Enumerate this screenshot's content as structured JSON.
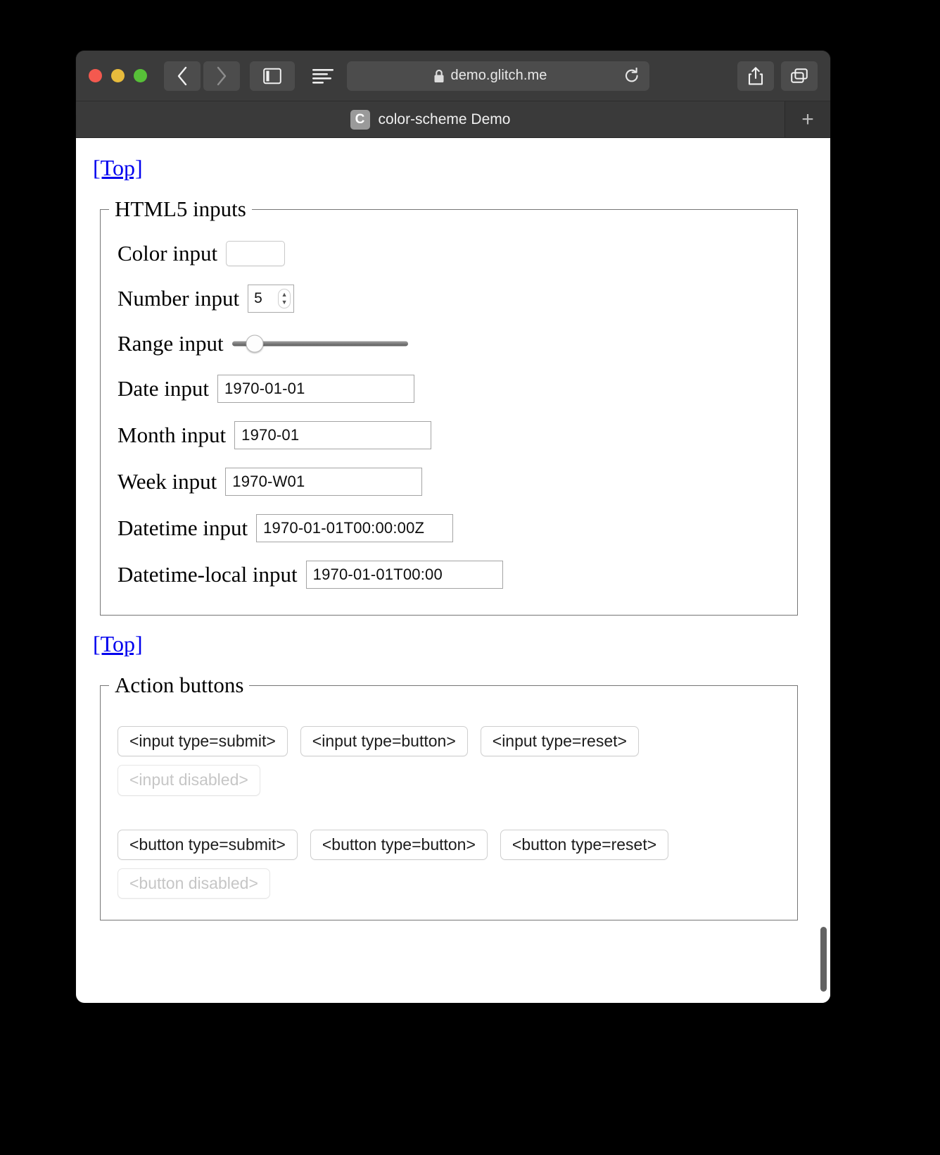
{
  "window": {
    "traffic_lights": [
      {
        "name": "close",
        "color": "#f4594f"
      },
      {
        "name": "minimize",
        "color": "#e7bb3c"
      },
      {
        "name": "zoom",
        "color": "#57c038"
      }
    ]
  },
  "toolbar": {
    "back_label": "‹",
    "forward_label": "›",
    "sidebar_label": "sidebar",
    "reader_label": "reader",
    "url": "demo.glitch.me",
    "lock_label": "secure",
    "reload_label": "reload",
    "share_label": "share",
    "tabs_overview_label": "tab overview"
  },
  "tabbar": {
    "active_tab": {
      "favicon_letter": "C",
      "title": "color-scheme Demo"
    },
    "new_tab_label": "+"
  },
  "page": {
    "top_link_1": "[Top]",
    "top_link_2": "[Top]",
    "fieldsets": [
      {
        "legend": "HTML5 inputs",
        "rows": [
          {
            "label": "Color input",
            "kind": "color",
            "value": "#000000"
          },
          {
            "label": "Number input",
            "kind": "number",
            "value": "5"
          },
          {
            "label": "Range input",
            "kind": "range",
            "value": "13"
          },
          {
            "label": "Date input",
            "kind": "text",
            "value": "1970-01-01"
          },
          {
            "label": "Month input",
            "kind": "text",
            "value": "1970-01"
          },
          {
            "label": "Week input",
            "kind": "text",
            "value": "1970-W01"
          },
          {
            "label": "Datetime input",
            "kind": "text",
            "value": "1970-01-01T00:00:00Z"
          },
          {
            "label": "Datetime-local input",
            "kind": "text",
            "value": "1970-01-01T00:00"
          }
        ]
      },
      {
        "legend": "Action buttons",
        "button_rows": [
          [
            "<input type=submit>",
            "<input type=button>",
            "<input type=reset>"
          ],
          [
            "<input disabled>"
          ],
          [
            "<button type=submit>",
            "<button type=button>",
            "<button type=reset>"
          ],
          [
            "<button disabled>"
          ]
        ]
      }
    ]
  },
  "colors": {
    "link": "#0000ee",
    "chrome": "#3b3b3b",
    "page_bg": "#ffffff",
    "swatch": "#000000",
    "scrollbar": "#636363"
  }
}
